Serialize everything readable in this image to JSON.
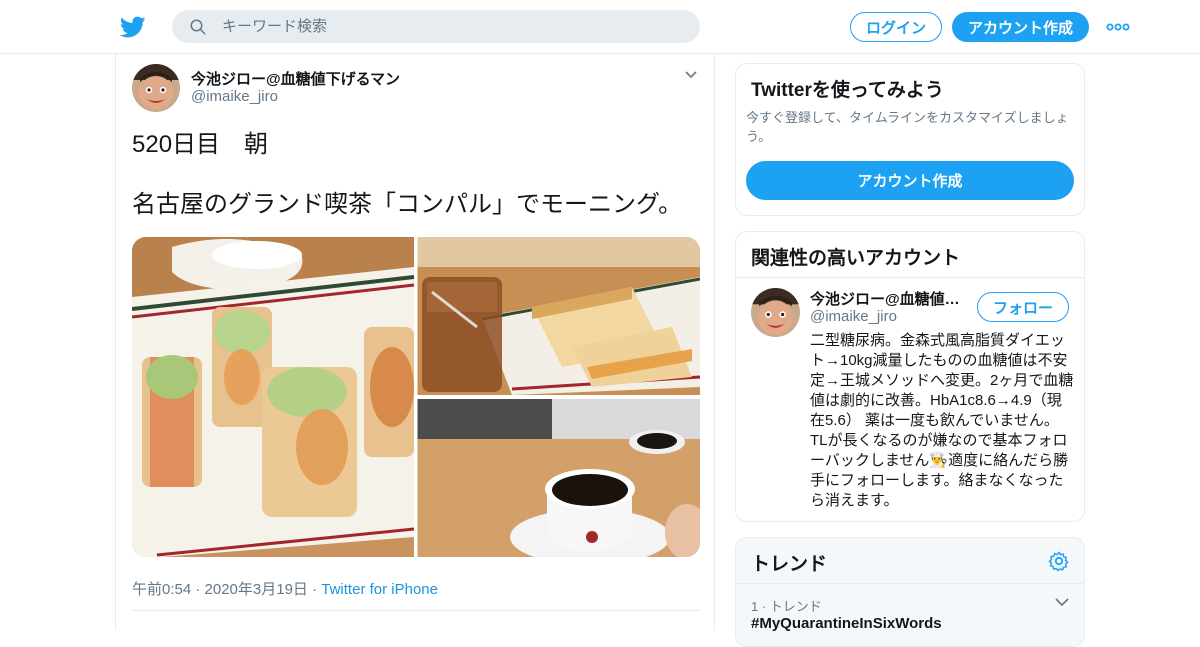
{
  "header": {
    "search_placeholder": "キーワード検索",
    "login_label": "ログイン",
    "signup_label": "アカウント作成"
  },
  "tweet": {
    "author_name": "今池ジロー@血糖値下げるマン",
    "author_handle": "@imaike_jiro",
    "text_line1": "520日目　朝",
    "text_line2": "名古屋のグランド喫茶「コンパル」でモーニング。",
    "timestamp": "午前0:54 · 2020年3月19日",
    "separator": "·",
    "source": "Twitter for iPhone"
  },
  "sidebar": {
    "signup_card": {
      "title": "Twitterを使ってみよう",
      "description": "今すぐ登録して、タイムラインをカスタマイズしましょう。",
      "button_label": "アカウント作成"
    },
    "relevant_card": {
      "title": "関連性の高いアカウント",
      "name": "今池ジロー@血糖値下げるマン",
      "handle": "@imaike_jiro",
      "follow_label": "フォロー",
      "bio": "二型糖尿病。金森式風高脂質ダイエット→10kg減量したものの血糖値は不安定→王城メソッドへ変更。2ヶ月で血糖値は劇的に改善。HbA1c8.6→4.9（現在5.6） 薬は一度も飲んでいません。TLが長くなるのが嫌なので基本フォローバックしません👨‍🍳適度に絡んだら勝手にフォローします。絡まなくなったら消えます。"
    },
    "trends_card": {
      "title": "トレンド",
      "items": [
        {
          "meta": "1 · トレンド",
          "name": "#MyQuarantineInSixWords"
        }
      ]
    }
  },
  "colors": {
    "brand_blue": "#1da1f2",
    "link_blue": "#1b95e0",
    "text_secondary": "#657786",
    "border": "#e6ecf0"
  },
  "icons": [
    "twitter-bird-icon",
    "search-icon",
    "more-dots-icon",
    "chevron-down-icon",
    "gear-icon"
  ]
}
